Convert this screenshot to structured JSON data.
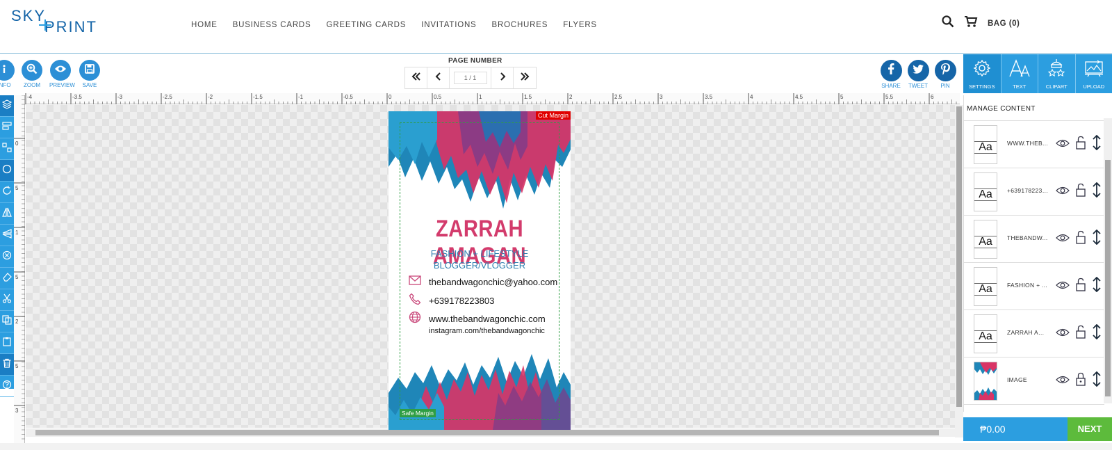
{
  "brand": {
    "logo_top": "SKY",
    "logo_bottom": "PRINT",
    "color": "#1565a8"
  },
  "nav": [
    "HOME",
    "BUSINESS CARDS",
    "GREETING CARDS",
    "INVITATIONS",
    "BROCHURES",
    "FLYERS"
  ],
  "header_right": {
    "bag_label": "BAG (0)",
    "search_icon": "search-icon",
    "cart_icon": "cart-icon"
  },
  "toolbar": {
    "tools": [
      {
        "label": "INFO",
        "icon": "info-icon"
      },
      {
        "label": "ZOOM",
        "icon": "zoom-icon"
      },
      {
        "label": "PREVIEW",
        "icon": "eye-icon"
      },
      {
        "label": "SAVE",
        "icon": "save-icon"
      }
    ],
    "page_number_label": "PAGE NUMBER",
    "page_value": "1 / 1",
    "social": [
      {
        "label": "SHARE",
        "icon": "facebook-icon"
      },
      {
        "label": "TWEET",
        "icon": "twitter-icon"
      },
      {
        "label": "PIN",
        "icon": "pinterest-icon"
      }
    ]
  },
  "right_tabs": [
    {
      "label": "SETTINGS",
      "icon": "gear-icon"
    },
    {
      "label": "TEXT",
      "icon": "text-icon"
    },
    {
      "label": "CLIPART",
      "icon": "clipart-icon"
    },
    {
      "label": "UPLOAD",
      "icon": "upload-icon"
    }
  ],
  "ruler": {
    "ticks": [
      "-4",
      "-3.5",
      "-3",
      "-2.5",
      "-2",
      "-1.5",
      "-1",
      "-0.5",
      "0",
      "0.5",
      "1",
      "1.5",
      "2",
      "2.5",
      "3",
      "3.5",
      "4",
      "4.5",
      "5",
      "5.5",
      "6"
    ],
    "vticks": [
      "0",
      "5",
      "1",
      "5",
      "2",
      "5",
      "3"
    ]
  },
  "card": {
    "cut_margin": "Cut Margin",
    "safe_margin": "Safe Margin",
    "name": "ZARRAH AMAGAN",
    "tagline1": "FASHION + LIFESTYLE",
    "tagline2": "BLOGGER/VLOGGER",
    "email": "thebandwagonchic@yahoo.com",
    "phone": "+639178223803",
    "website": "www.thebandwagonchic.com",
    "instagram": "instagram.com/thebandwagonchic",
    "name_color": "#d33b6c",
    "tag_color": "#2f7fb0"
  },
  "manage": {
    "title": "MANAGE CONTENT",
    "layers": [
      {
        "name": "WWW.THEB...",
        "type": "text"
      },
      {
        "name": "+6391782235...",
        "type": "text"
      },
      {
        "name": "THEBANDW...",
        "type": "text"
      },
      {
        "name": "FASHION + ...",
        "type": "text"
      },
      {
        "name": "ZARRAH AM...",
        "type": "text"
      },
      {
        "name": "IMAGE",
        "type": "image"
      }
    ]
  },
  "footer": {
    "price": "₱0.00",
    "next": "NEXT"
  }
}
